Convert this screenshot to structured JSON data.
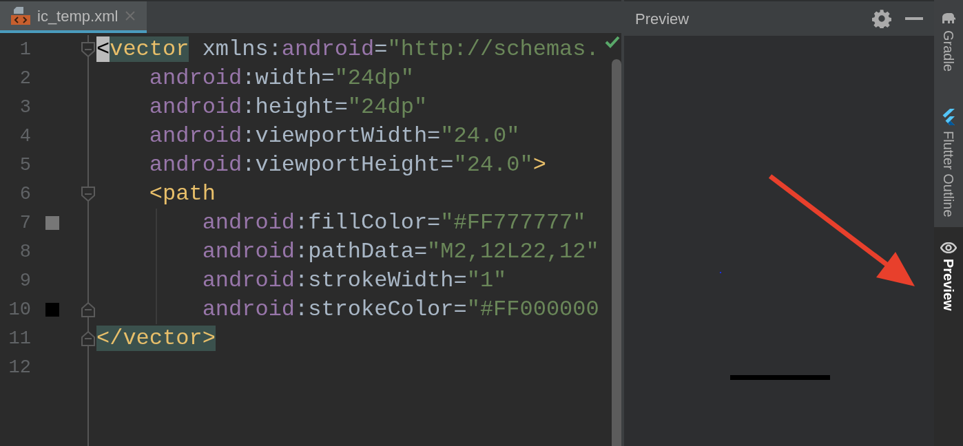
{
  "editor": {
    "tabs": [
      {
        "label": "ic_temp.xml",
        "selected": true
      }
    ],
    "lines": [
      {
        "number": "1",
        "fold": {
          "kind": "start"
        },
        "tokens": [
          {
            "text": "<",
            "kind": "caret"
          },
          {
            "text": "vector",
            "kind": "matchtag"
          },
          {
            "text": " xmlns:",
            "kind": "plain"
          },
          {
            "text": "android",
            "kind": "ns"
          },
          {
            "text": "=",
            "kind": "plain"
          },
          {
            "text": "\"http://schemas.",
            "kind": "value"
          }
        ]
      },
      {
        "number": "2",
        "tokens": [
          {
            "text": "    android",
            "kind": "ns"
          },
          {
            "text": ":width=",
            "kind": "plain"
          },
          {
            "text": "\"24dp\"",
            "kind": "value"
          }
        ]
      },
      {
        "number": "3",
        "tokens": [
          {
            "text": "    android",
            "kind": "ns"
          },
          {
            "text": ":height=",
            "kind": "plain"
          },
          {
            "text": "\"24dp\"",
            "kind": "value"
          }
        ]
      },
      {
        "number": "4",
        "tokens": [
          {
            "text": "    android",
            "kind": "ns"
          },
          {
            "text": ":viewportWidth=",
            "kind": "plain"
          },
          {
            "text": "\"24.0\"",
            "kind": "value"
          }
        ]
      },
      {
        "number": "5",
        "tokens": [
          {
            "text": "    android",
            "kind": "ns"
          },
          {
            "text": ":viewportHeight=",
            "kind": "plain"
          },
          {
            "text": "\"24.0\"",
            "kind": "value"
          },
          {
            "text": ">",
            "kind": "tag"
          }
        ]
      },
      {
        "number": "6",
        "fold": {
          "kind": "start"
        },
        "tokens": [
          {
            "text": "    <path",
            "kind": "tag"
          }
        ]
      },
      {
        "number": "7",
        "color": "#777777",
        "tokens": [
          {
            "text": "        android",
            "kind": "ns"
          },
          {
            "text": ":fillColor=",
            "kind": "plain"
          },
          {
            "text": "\"#FF777777\"",
            "kind": "value"
          }
        ]
      },
      {
        "number": "8",
        "tokens": [
          {
            "text": "        android",
            "kind": "ns"
          },
          {
            "text": ":pathData=",
            "kind": "plain"
          },
          {
            "text": "\"M2,12L22,12\"",
            "kind": "value"
          }
        ]
      },
      {
        "number": "9",
        "tokens": [
          {
            "text": "        android",
            "kind": "ns"
          },
          {
            "text": ":strokeWidth=",
            "kind": "plain"
          },
          {
            "text": "\"1\"",
            "kind": "value"
          }
        ]
      },
      {
        "number": "10",
        "fold": {
          "kind": "end"
        },
        "color": "#000000",
        "tokens": [
          {
            "text": "        android",
            "kind": "ns"
          },
          {
            "text": ":strokeColor=",
            "kind": "plain"
          },
          {
            "text": "\"#FF000000",
            "kind": "value"
          }
        ]
      },
      {
        "number": "11",
        "fold": {
          "kind": "end"
        },
        "tokens": [
          {
            "text": "</vector>",
            "kind": "matchtag"
          }
        ]
      },
      {
        "number": "12"
      }
    ]
  },
  "preview": {
    "title": "Preview"
  },
  "side_tabs": [
    {
      "label": "Gradle",
      "selected": false
    },
    {
      "label": "Flutter Outline",
      "selected": false
    },
    {
      "label": "Preview",
      "selected": true
    }
  ]
}
